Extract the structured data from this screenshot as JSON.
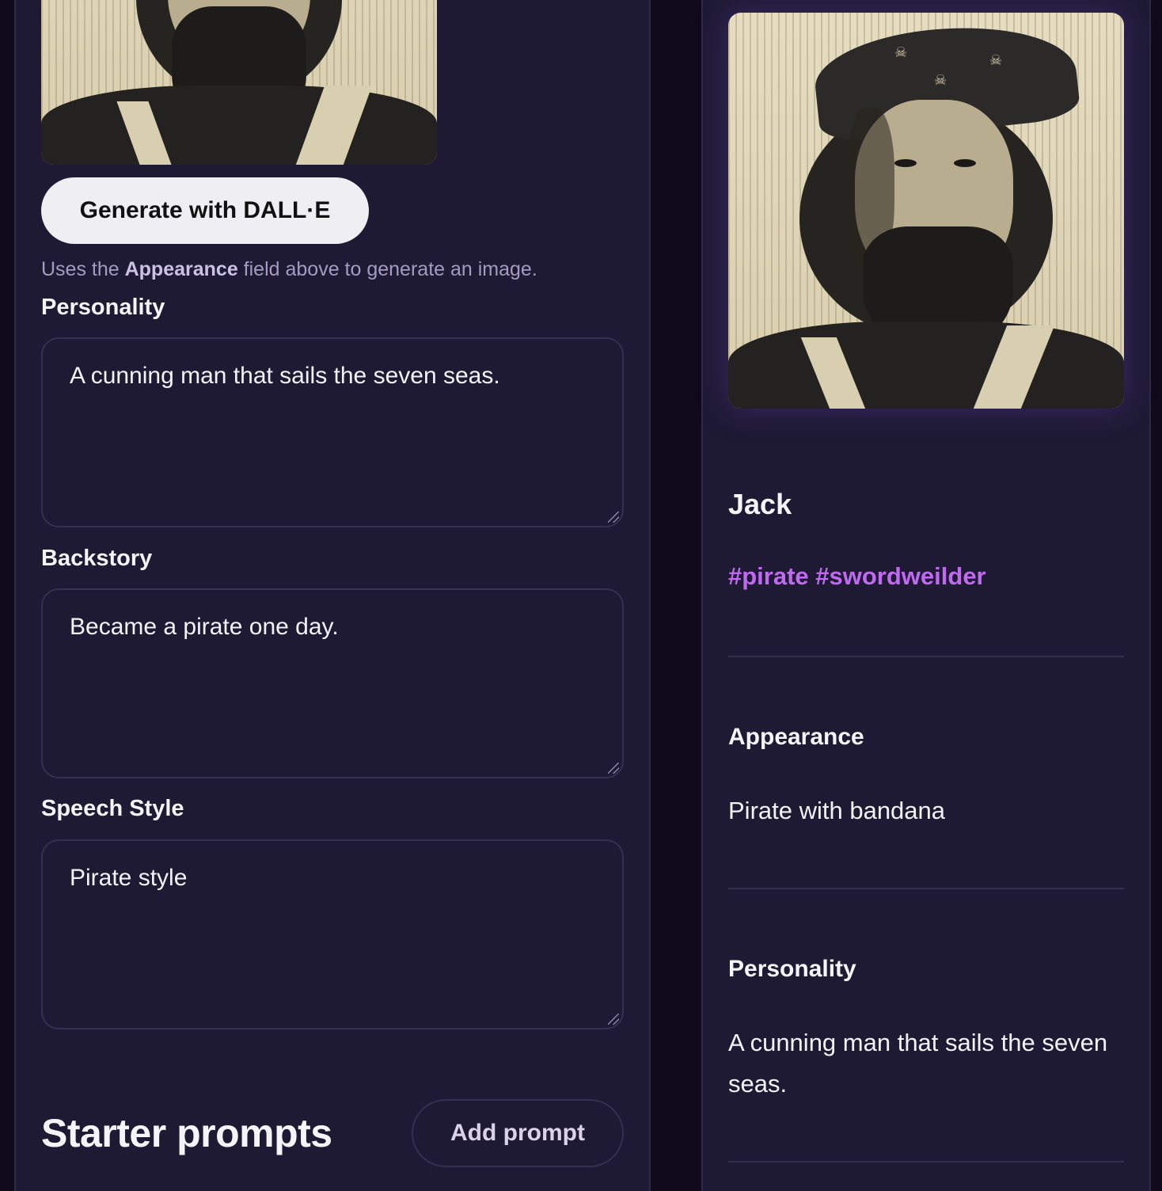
{
  "editor": {
    "generate_button": "Generate with DALL·E",
    "hint_prefix": "Uses the ",
    "hint_bold": "Appearance",
    "hint_suffix": " field above to generate an image.",
    "fields": [
      {
        "label": "Personality",
        "value": "A cunning man that sails the seven seas."
      },
      {
        "label": "Backstory",
        "value": "Became a pirate one day."
      },
      {
        "label": "Speech Style",
        "value": "Pirate style"
      }
    ],
    "starter_prompts_title": "Starter prompts",
    "add_prompt_button": "Add prompt"
  },
  "preview": {
    "name": "Jack",
    "tags": "#pirate #swordweilder",
    "sections": [
      {
        "title": "Appearance",
        "body": "Pirate with bandana"
      },
      {
        "title": "Personality",
        "body": "A cunning man that sails the seven seas."
      }
    ]
  },
  "colors": {
    "background": "#0f0b1a",
    "panel": "#1e1a33",
    "tag_accent": "#c06af0",
    "button_light": "#efeef3"
  }
}
